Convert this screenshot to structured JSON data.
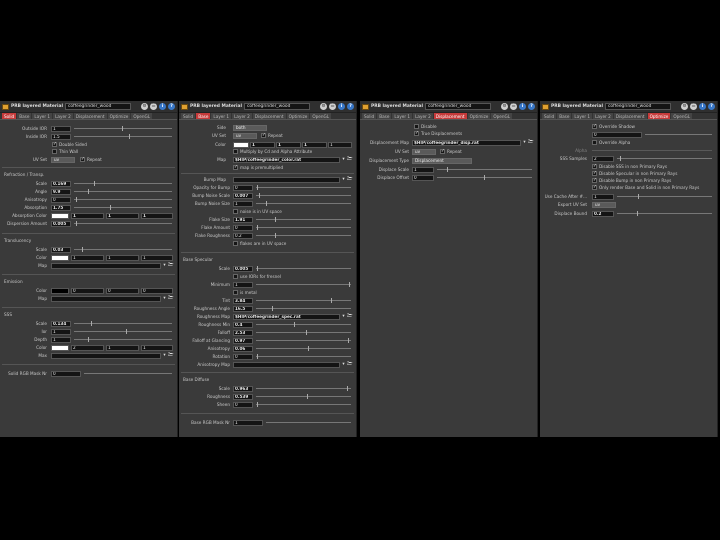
{
  "common": {
    "title": "PRB layered Material",
    "material_name": "coffeegrinder_wood",
    "icons": [
      "gear-icon",
      "stack-icon",
      "info-icon",
      "help-icon"
    ]
  },
  "panels": [
    {
      "tabs": [
        "Solid",
        "Base",
        "Layer 1",
        "Layer 2",
        "Displacement",
        "Optimize",
        "OpenGL"
      ],
      "active": 0
    },
    {
      "tabs": [
        "Solid",
        "Base",
        "Layer 1",
        "Layer 2",
        "Displacement",
        "Optimize",
        "OpenGL"
      ],
      "active": 1
    },
    {
      "tabs": [
        "Solid",
        "Base",
        "Layer 1",
        "Layer 2",
        "Displacement",
        "Optimize",
        "OpenGL"
      ],
      "active": 4
    },
    {
      "tabs": [
        "Solid",
        "Base",
        "Layer 1",
        "Layer 2",
        "Displacement",
        "Optimize",
        "OpenGL"
      ],
      "active": 5
    }
  ],
  "solid": {
    "outside_ior_label": "Outside IOR",
    "outside_ior": "1",
    "inside_ior_label": "Inside IOR",
    "inside_ior": "1.5",
    "double_sided": "Double Sided",
    "thin_wall": "Thin Wall",
    "uv_set_label": "UV Set",
    "uv_set": "uv",
    "repeat": "Repeat",
    "refraction_section": "Refraction / Transp.",
    "scale_label": "Scale",
    "scale": "0.169",
    "angle_label": "Angle",
    "angle": "9.9",
    "anisotropy_label": "Anisotropy",
    "anisotropy": "0",
    "absorption_label": "Absorption",
    "absorption": "1.75",
    "absorption_color_label": "Absorption Color",
    "absorption_color": [
      "1",
      "1",
      "1"
    ],
    "dispersion_label": "Dispersion Amount",
    "dispersion": "0.005",
    "translucency_section": "Translucency",
    "t_scale_label": "Scale",
    "t_scale": "0.03",
    "t_color_label": "Color",
    "t_color": [
      "1",
      "1",
      "1"
    ],
    "t_map_label": "Map",
    "emission_section": "Emission",
    "e_color_label": "Color",
    "e_color": [
      "0",
      "0",
      "0"
    ],
    "e_map_label": "Map",
    "sss_section": "SSS",
    "s_scale_label": "Scale",
    "s_scale": "0.134",
    "s_ior_label": "Ior",
    "s_ior": "1",
    "s_depth_label": "Depth",
    "s_depth": "1",
    "s_color_label": "Color",
    "s_color": [
      "2",
      "1",
      "1"
    ],
    "s_max_label": "Max",
    "rgb_mask_label": "Solid RGB Mask Nr",
    "rgb_mask": "0"
  },
  "base": {
    "side_label": "Side",
    "side": "both",
    "uv_set_label": "UV Set",
    "uv_set": "uv",
    "repeat": "Repeat",
    "color_label": "Color",
    "color": [
      "1",
      "1",
      "1",
      "1"
    ],
    "multiply_note": "Multiply by Cd and Alpha Attribute",
    "map_label": "Map",
    "map": "$HIP/coffeegrinder_color.rat",
    "premult": "map is premultiplied",
    "bump_map_label": "Bump Map",
    "opacity_bump_label": "Opacity for Bump",
    "opacity_bump": "0",
    "bump_noise_scale_label": "Bump Noise Scale",
    "bump_noise_scale": "0.007",
    "bump_noise_size_label": "Bump Noise Size",
    "bump_noise_size": "1",
    "noise_uv": "noise is in UV space",
    "flake_size_label": "Flake Size",
    "flake_size": "1.91",
    "flake_amount_label": "Flake Amount",
    "flake_amount": "0",
    "flake_rough_label": "Flake Roughness",
    "flake_rough": "0.2",
    "flakes_uv": "flakes are in UV space",
    "specular_section": "Base Specular",
    "spec_scale_label": "Scale",
    "spec_scale": "0.005",
    "use_iors": "use IORs for fresnel",
    "minimum_label": "Minimum",
    "minimum": "1",
    "is_metal": "is metal",
    "tint_label": "Tint",
    "tint": "3.84",
    "rough_angle_label": "Roughness Angle",
    "rough_angle": "16.5",
    "rough_map_label": "Roughness Map",
    "rough_map": "$HIP/coffeegrinder_spec.rat",
    "rough_min_label": "Roughness Min",
    "rough_min": "0.4",
    "falloff_label": "Falloff",
    "falloff": "2.53",
    "falloff_glancing_label": "Falloff at Glancing",
    "falloff_glancing": "0.97",
    "anisotropy_label": "Anisotropy",
    "anisotropy": "0.06",
    "rotation_label": "Rotation",
    "rotation": "0",
    "aniso_map_label": "Anisotropy Map",
    "diffuse_section": "Base Diffuse",
    "d_scale_label": "Scale",
    "d_scale": "0.963",
    "d_rough_label": "Roughness",
    "d_rough": "0.539",
    "sheen_label": "Sheen",
    "sheen": "0",
    "rgb_mask_label": "Base RGB Mask Nr",
    "rgb_mask": "1"
  },
  "displacement": {
    "disable": "Disable",
    "true_disp": "True Displacements",
    "map_label": "Displacement Map",
    "map": "$HIP/coffeegrinder_disp.rat",
    "uv_set_label": "UV Set",
    "uv_set": "uv",
    "repeat": "Repeat",
    "type_label": "Displacement Type",
    "type": "Displacement",
    "scale_label": "Displace Scale",
    "scale": "1",
    "offset_label": "Displace Offset",
    "offset": "0"
  },
  "optimize": {
    "override_shadow": "Override Shadow",
    "shadow_val": "0",
    "override_alpha": "Override Alpha",
    "alpha_label": "Alpha",
    "sss_samples_label": "SSS Samples",
    "sss_samples": "2",
    "opts": [
      "Disable SSS in non Primary Rays",
      "Disable Specular in non Primary Rays",
      "Disable Bump in non Primary Rays",
      "Only render Base and Solid in non Primary Rays"
    ],
    "cache_label": "Use Cache After #...",
    "cache": "1",
    "export_uv_label": "Export UV Set",
    "export_uv": "uv",
    "displace_bound_label": "Displace Bound",
    "displace_bound": "0.2"
  }
}
